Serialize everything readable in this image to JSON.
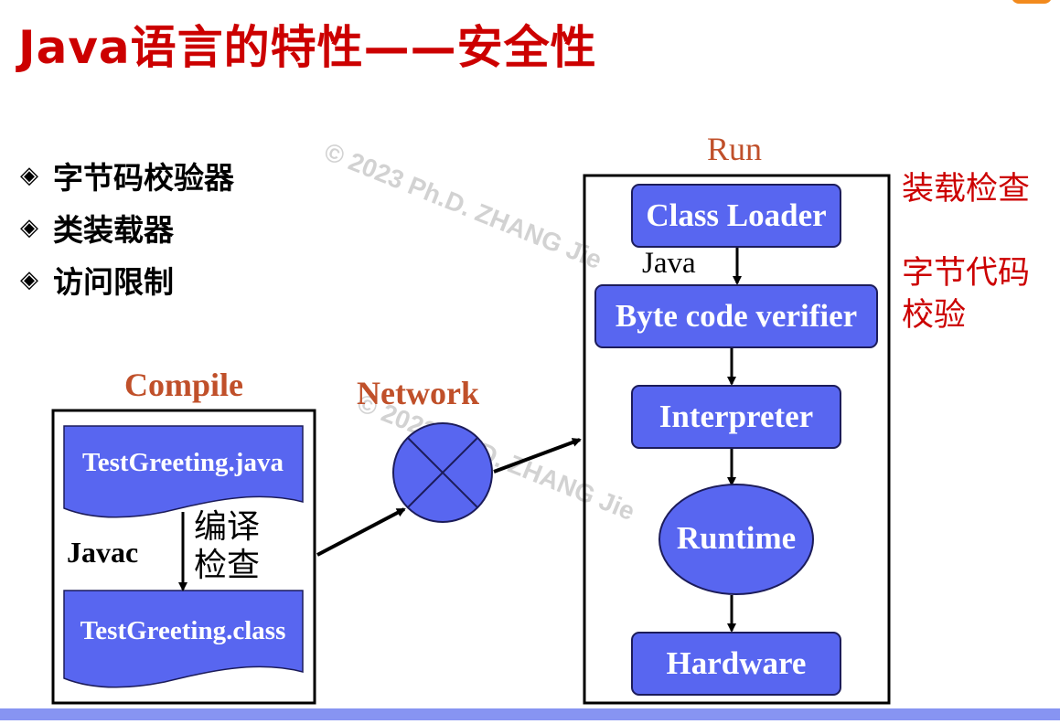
{
  "title": "Java语言的特性——安全性",
  "bullets": [
    {
      "symbol": "◈",
      "text": "字节码校验器"
    },
    {
      "symbol": "◈",
      "text": "类装载器"
    },
    {
      "symbol": "◈",
      "text": "访问限制"
    }
  ],
  "watermark": "© 2023 Ph.D. ZHANG Jie",
  "compile": {
    "title": "Compile",
    "source_file": "TestGreeting.java",
    "class_file": "TestGreeting.class",
    "tool": "Javac",
    "step_note_line1": "编译",
    "step_note_line2": "检查"
  },
  "network": {
    "title": "Network"
  },
  "run": {
    "title": "Run",
    "stages": {
      "class_loader": "Class Loader",
      "byte_code_verifier": "Byte code verifier",
      "interpreter": "Interpreter",
      "runtime": "Runtime",
      "hardware": "Hardware"
    },
    "java_label": "Java"
  },
  "side_notes": {
    "loading_check": "装载检查",
    "bytecode_check_line1": "字节代码",
    "bytecode_check_line2": "校验"
  },
  "colors": {
    "title_red": "#cc0000",
    "box_blue": "#5866f0",
    "section_title_brown": "#c0502a",
    "bottom_bar": "#8794f2"
  }
}
